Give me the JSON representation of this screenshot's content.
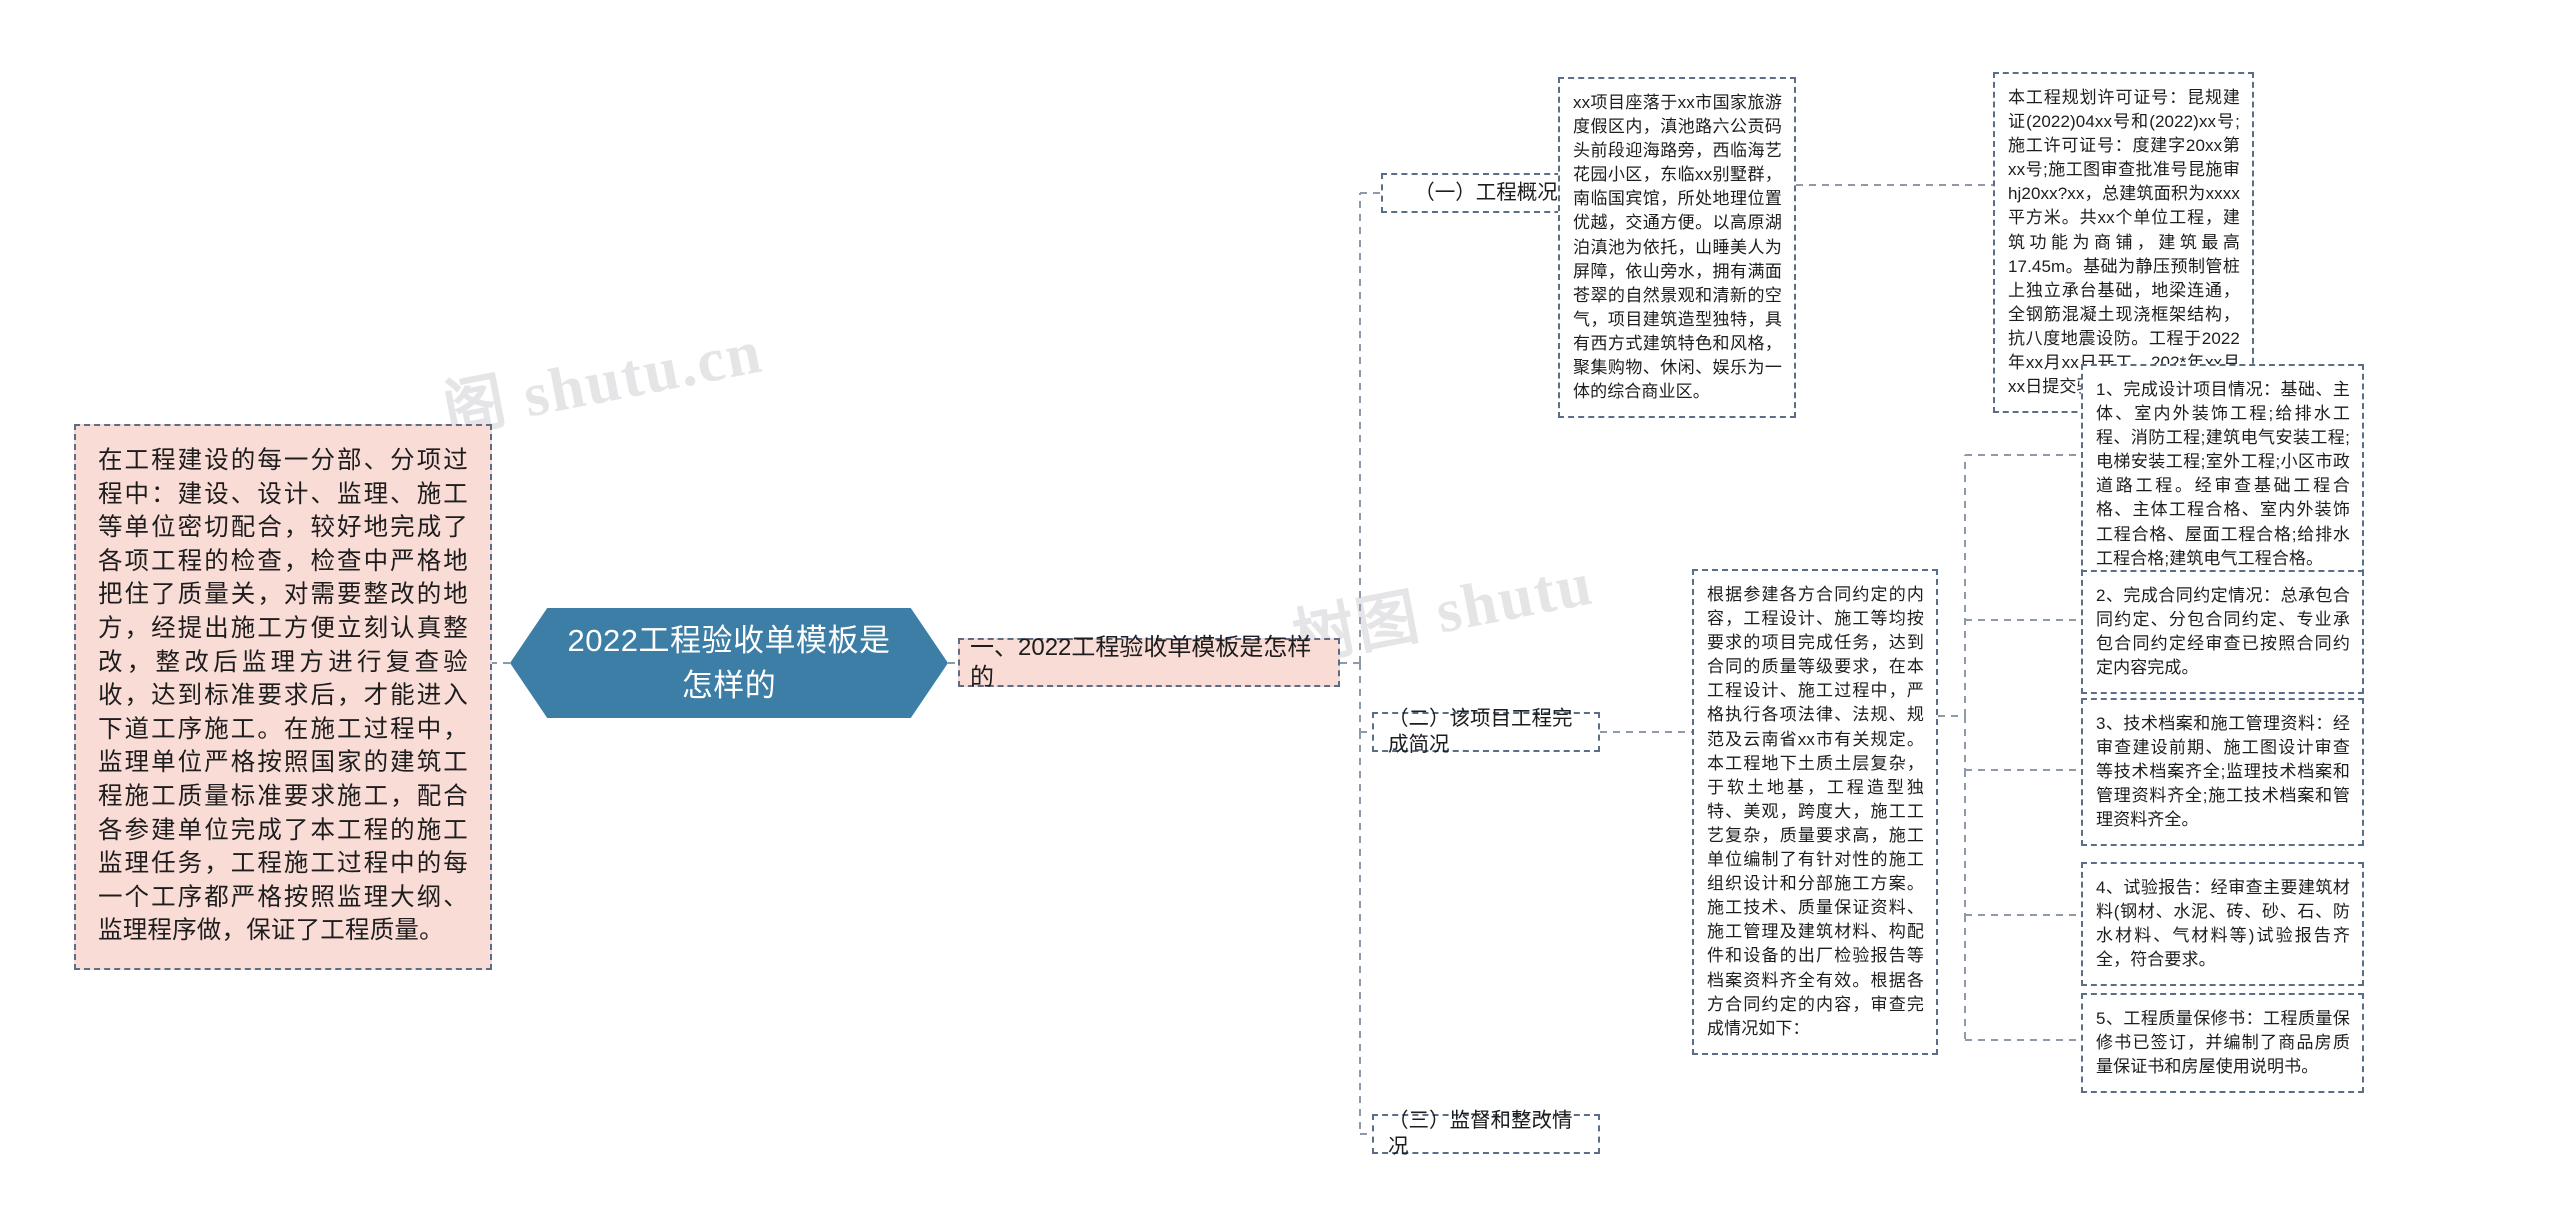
{
  "watermarks": {
    "left": "阁 shutu.cn",
    "right": "树图 shutu"
  },
  "central": {
    "title": "2022工程验收单模板是怎样的",
    "fill_color": "#3d7ea6",
    "text_color": "#ffffff"
  },
  "summary": {
    "text": "在工程建设的每一分部、分项过程中：建设、设计、监理、施工等单位密切配合，较好地完成了各项工程的检查，检查中严格地把住了质量关，对需要整改的地方，经提出施工方便立刻认真整改，整改后监理方进行复查验收，达到标准要求后，才能进入下道工序施工。在施工过程中，监理单位严格按照国家的建筑工程施工质量标准要求施工，配合各参建单位完成了本工程的施工监理任务，工程施工过程中的每一个工序都严格按照监理大纲、监理程序做，保证了工程质量。",
    "fill_color": "#fadcd7",
    "border_color": "#5b6e87"
  },
  "level1": {
    "label": "一、2022工程验收单模板是怎样的",
    "fill_color": "#fadcd7"
  },
  "level2": [
    {
      "label": "（一）工程概况"
    },
    {
      "label": "（二）该项目工程完成简况"
    },
    {
      "label": "（三）监督和整改情况"
    }
  ],
  "details": {
    "overview": "xx项目座落于xx市国家旅游度假区内，滇池路六公贡码头前段迎海路旁，西临海艺花园小区，东临xx别墅群，南临国宾馆，所处地理位置优越，交通方便。以高原湖泊滇池为依托，山睡美人为屏障，依山旁水，拥有满面苍翠的自然景观和清新的空气，项目建筑造型独特，具有西方式建筑特色和风格，聚集购物、休闲、娱乐为一体的综合商业区。",
    "permit": "本工程规划许可证号：昆规建证(2022)04xx号和(2022)xx号;施工许可证号：度建字20xx第xx号;施工图审查批准号昆施审hj20xx?xx，总建筑面积为xxxx平方米。共xx个单位工程，建筑功能为商铺，建筑最高17.45m。基础为静压预制管桩上独立承台基础，地梁连通，全钢筋混凝土现浇框架结构，抗八度地震设防。工程于2022年xx月xx日开工，202*年xx月xx日提交验收。",
    "completion": "根据参建各方合同约定的内容，工程设计、施工等均按要求的项目完成任务，达到合同的质量等级要求，在本工程设计、施工过程中，严格执行各项法律、法规、规范及云南省xx市有关规定。本工程地下土质土层复杂，于软土地基，工程造型独特、美观，跨度大，施工工艺复杂，质量要求高，施工单位编制了有针对性的施工组织设计和分部施工方案。施工技术、质量保证资料、施工管理及建筑材料、构配件和设备的出厂检验报告等档案资料齐全有效。根据各方合同约定的内容，审查完成情况如下："
  },
  "items": [
    {
      "text": "1、完成设计项目情况：基础、主体、室内外装饰工程;给排水工程、消防工程;建筑电气安装工程;电梯安装工程;室外工程;小区市政道路工程。经审查基础工程合格、主体工程合格、室内外装饰工程合格、屋面工程合格;给排水工程合格;建筑电气工程合格。"
    },
    {
      "text": "2、完成合同约定情况：总承包合同约定、分包合同约定、专业承包合同约定经审查已按照合同约定内容完成。"
    },
    {
      "text": "3、技术档案和施工管理资料：经审查建设前期、施工图设计审查等技术档案齐全;监理技术档案和管理资料齐全;施工技术档案和管理资料齐全。"
    },
    {
      "text": "4、试验报告：经审查主要建筑材料(钢材、水泥、砖、砂、石、防水材料、气材料等)试验报告齐全，符合要求。"
    },
    {
      "text": "5、工程质量保修书：工程质量保修书已签订，并编制了商品房质量保证书和房屋使用说明书。"
    }
  ]
}
